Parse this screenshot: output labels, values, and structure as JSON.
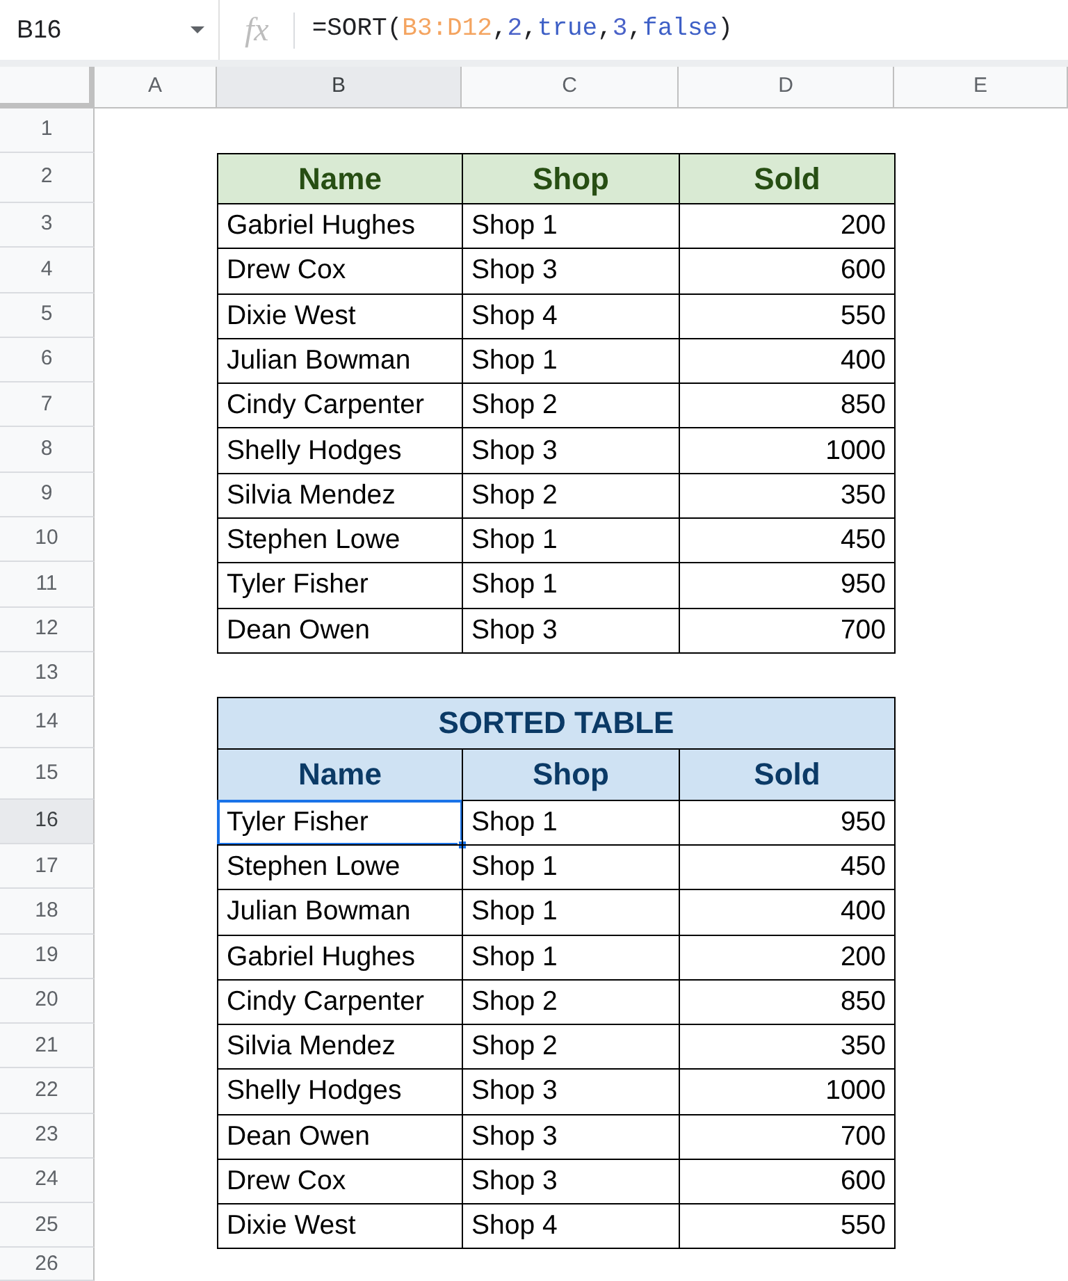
{
  "name_box": "B16",
  "fx_label": "fx",
  "formula": [
    {
      "kind": "plain",
      "text": "=SORT("
    },
    {
      "kind": "range",
      "text": "B3:D12"
    },
    {
      "kind": "plain",
      "text": ","
    },
    {
      "kind": "number",
      "text": "2"
    },
    {
      "kind": "plain",
      "text": ","
    },
    {
      "kind": "boolean",
      "text": "true"
    },
    {
      "kind": "plain",
      "text": ","
    },
    {
      "kind": "number",
      "text": "3"
    },
    {
      "kind": "plain",
      "text": ","
    },
    {
      "kind": "boolean",
      "text": "false"
    },
    {
      "kind": "plain",
      "text": ")"
    }
  ],
  "columns": [
    {
      "label": "A",
      "selected": false
    },
    {
      "label": "B",
      "selected": true
    },
    {
      "label": "C",
      "selected": false
    },
    {
      "label": "D",
      "selected": false
    },
    {
      "label": "E",
      "selected": false
    }
  ],
  "rows": [
    {
      "number": "1",
      "selected": false,
      "kind": "empty"
    },
    {
      "number": "2",
      "selected": false,
      "kind": "header",
      "color": "#d9ead3",
      "cells": [
        "Name",
        "Shop",
        "Sold"
      ]
    },
    {
      "number": "3",
      "selected": false,
      "kind": "data",
      "cells": [
        {
          "text": "Gabriel Hughes",
          "selected": false
        },
        {
          "text": "Shop 1",
          "selected": false
        },
        {
          "text": "200",
          "selected": false
        }
      ]
    },
    {
      "number": "4",
      "selected": false,
      "kind": "data",
      "cells": [
        {
          "text": "Drew Cox",
          "selected": false
        },
        {
          "text": "Shop 3",
          "selected": false
        },
        {
          "text": "600",
          "selected": false
        }
      ]
    },
    {
      "number": "5",
      "selected": false,
      "kind": "data",
      "cells": [
        {
          "text": "Dixie West",
          "selected": false
        },
        {
          "text": "Shop 4",
          "selected": false
        },
        {
          "text": "550",
          "selected": false
        }
      ]
    },
    {
      "number": "6",
      "selected": false,
      "kind": "data",
      "cells": [
        {
          "text": "Julian Bowman",
          "selected": false
        },
        {
          "text": "Shop 1",
          "selected": false
        },
        {
          "text": "400",
          "selected": false
        }
      ]
    },
    {
      "number": "7",
      "selected": false,
      "kind": "data",
      "cells": [
        {
          "text": "Cindy Carpenter",
          "selected": false
        },
        {
          "text": "Shop 2",
          "selected": false
        },
        {
          "text": "850",
          "selected": false
        }
      ]
    },
    {
      "number": "8",
      "selected": false,
      "kind": "data",
      "cells": [
        {
          "text": "Shelly Hodges",
          "selected": false
        },
        {
          "text": "Shop 3",
          "selected": false
        },
        {
          "text": "1000",
          "selected": false
        }
      ]
    },
    {
      "number": "9",
      "selected": false,
      "kind": "data",
      "cells": [
        {
          "text": "Silvia Mendez",
          "selected": false
        },
        {
          "text": "Shop 2",
          "selected": false
        },
        {
          "text": "350",
          "selected": false
        }
      ]
    },
    {
      "number": "10",
      "selected": false,
      "kind": "data",
      "cells": [
        {
          "text": "Stephen Lowe",
          "selected": false
        },
        {
          "text": "Shop 1",
          "selected": false
        },
        {
          "text": "450",
          "selected": false
        }
      ]
    },
    {
      "number": "11",
      "selected": false,
      "kind": "data",
      "cells": [
        {
          "text": "Tyler Fisher",
          "selected": false
        },
        {
          "text": "Shop 1",
          "selected": false
        },
        {
          "text": "950",
          "selected": false
        }
      ]
    },
    {
      "number": "12",
      "selected": false,
      "kind": "data",
      "cells": [
        {
          "text": "Dean Owen",
          "selected": false
        },
        {
          "text": "Shop 3",
          "selected": false
        },
        {
          "text": "700",
          "selected": false
        }
      ]
    },
    {
      "number": "13",
      "selected": false,
      "kind": "empty"
    },
    {
      "number": "14",
      "selected": false,
      "kind": "title",
      "color": "#cfe2f3",
      "text": "SORTED TABLE"
    },
    {
      "number": "15",
      "selected": false,
      "kind": "header",
      "color": "#cfe2f3",
      "cells": [
        "Name",
        "Shop",
        "Sold"
      ]
    },
    {
      "number": "16",
      "selected": true,
      "kind": "data",
      "cells": [
        {
          "text": "Tyler Fisher",
          "selected": true
        },
        {
          "text": "Shop 1",
          "selected": false
        },
        {
          "text": "950",
          "selected": false
        }
      ]
    },
    {
      "number": "17",
      "selected": false,
      "kind": "data",
      "cells": [
        {
          "text": "Stephen Lowe",
          "selected": false
        },
        {
          "text": "Shop 1",
          "selected": false
        },
        {
          "text": "450",
          "selected": false
        }
      ]
    },
    {
      "number": "18",
      "selected": false,
      "kind": "data",
      "cells": [
        {
          "text": "Julian Bowman",
          "selected": false
        },
        {
          "text": "Shop 1",
          "selected": false
        },
        {
          "text": "400",
          "selected": false
        }
      ]
    },
    {
      "number": "19",
      "selected": false,
      "kind": "data",
      "cells": [
        {
          "text": "Gabriel Hughes",
          "selected": false
        },
        {
          "text": "Shop 1",
          "selected": false
        },
        {
          "text": "200",
          "selected": false
        }
      ]
    },
    {
      "number": "20",
      "selected": false,
      "kind": "data",
      "cells": [
        {
          "text": "Cindy Carpenter",
          "selected": false
        },
        {
          "text": "Shop 2",
          "selected": false
        },
        {
          "text": "850",
          "selected": false
        }
      ]
    },
    {
      "number": "21",
      "selected": false,
      "kind": "data",
      "cells": [
        {
          "text": "Silvia Mendez",
          "selected": false
        },
        {
          "text": "Shop 2",
          "selected": false
        },
        {
          "text": "350",
          "selected": false
        }
      ]
    },
    {
      "number": "22",
      "selected": false,
      "kind": "data",
      "cells": [
        {
          "text": "Shelly Hodges",
          "selected": false
        },
        {
          "text": "Shop 3",
          "selected": false
        },
        {
          "text": "1000",
          "selected": false
        }
      ]
    },
    {
      "number": "23",
      "selected": false,
      "kind": "data",
      "cells": [
        {
          "text": "Dean Owen",
          "selected": false
        },
        {
          "text": "Shop 3",
          "selected": false
        },
        {
          "text": "700",
          "selected": false
        }
      ]
    },
    {
      "number": "24",
      "selected": false,
      "kind": "data",
      "cells": [
        {
          "text": "Drew Cox",
          "selected": false
        },
        {
          "text": "Shop 3",
          "selected": false
        },
        {
          "text": "600",
          "selected": false
        }
      ]
    },
    {
      "number": "25",
      "selected": false,
      "kind": "data",
      "cells": [
        {
          "text": "Dixie West",
          "selected": false
        },
        {
          "text": "Shop 4",
          "selected": false
        },
        {
          "text": "550",
          "selected": false
        }
      ]
    },
    {
      "number": "26",
      "selected": false,
      "kind": "empty"
    }
  ]
}
